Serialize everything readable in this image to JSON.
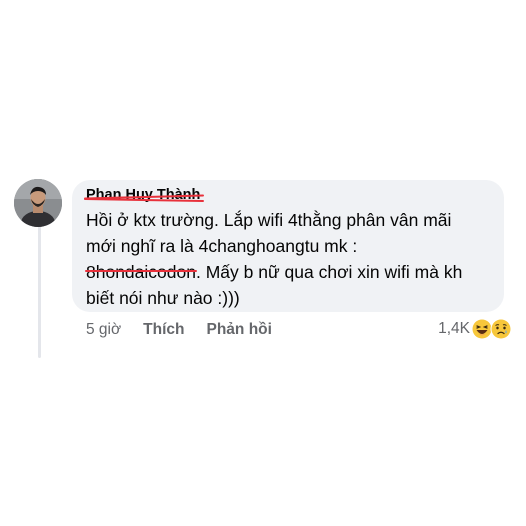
{
  "comment": {
    "author": "Phan Huy Thành",
    "lines": {
      "line1": "Hồi ở ktx trường. Lắp wifi 4thằng phân vân mãi",
      "line2": "mới nghĩ ra là 4changhoangtu mk :",
      "line3_redacted": "8hondaicodon",
      "line3_rest": ". Mấy b nữ qua chơi xin wifi mà kh",
      "line4": "biết nói như nào :)))"
    }
  },
  "actions": {
    "time": "5 giờ",
    "like_label": "Thích",
    "reply_label": "Phản hồi"
  },
  "reactions": {
    "count": "1,4K",
    "icons": [
      "haha-emoji-icon",
      "sad-emoji-icon"
    ]
  },
  "colors": {
    "bubble": "#f0f2f5",
    "redaction": "#e8313b",
    "meta_text": "#65676b"
  }
}
